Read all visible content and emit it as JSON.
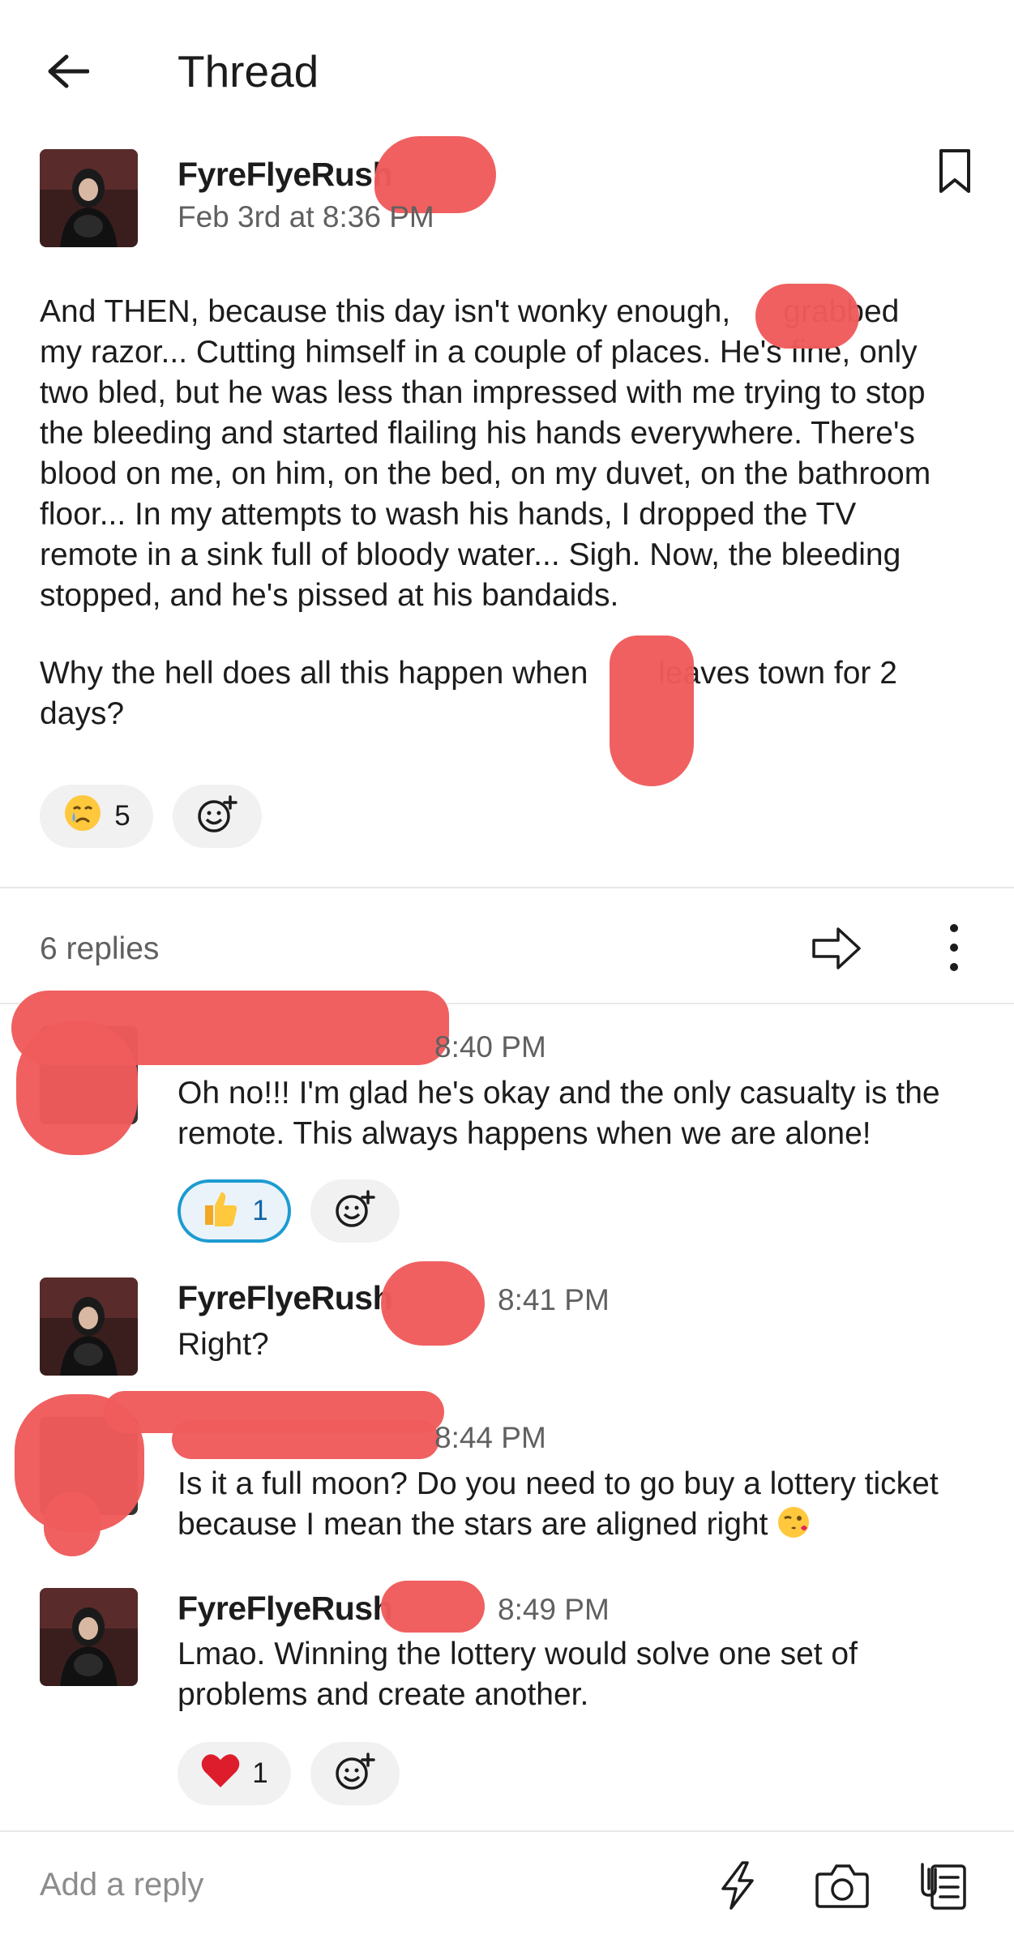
{
  "header": {
    "title": "Thread"
  },
  "parent": {
    "author": "FyreFlyeRush",
    "timestamp": "Feb 3rd at 8:36 PM",
    "text_p1": "And THEN, because this day isn't wonky enough,      grabbed\nmy razor... Cutting himself in a couple of places. He's fine, only\ntwo bled, but he was less than impressed with me trying to stop\nthe bleeding and started flailing his hands everywhere. There's\nblood on me, on him, on the bed, on my duvet, on the bathroom\nfloor... In my attempts to wash his hands, I dropped the TV\nremote in a sink full of bloody water... Sigh. Now, the bleeding\nstopped, and he's pissed at his bandaids.",
    "text_p2": "Why the hell does all this happen when        leaves town for 2\ndays?",
    "reaction": {
      "emoji": "crying-face",
      "count": "5"
    }
  },
  "thread_bar": {
    "replies_label": "6 replies"
  },
  "replies": [
    {
      "timestamp": "8:40 PM",
      "text": "Oh no!!! I'm glad he's okay and the only casualty is the\nremote. This always happens when we are alone!",
      "reaction": {
        "emoji": "thumbs-up",
        "count": "1"
      }
    },
    {
      "author": "FyreFlyeRush",
      "timestamp": "8:41 PM",
      "text": "Right?"
    },
    {
      "timestamp": "8:44 PM",
      "text": "Is it a full moon? Do you need to go buy a lottery ticket\nbecause I mean the stars are aligned right",
      "trailing_emoji": "winking-kiss-face"
    },
    {
      "author": "FyreFlyeRush",
      "timestamp": "8:49 PM",
      "text": "Lmao. Winning the lottery would solve one set of\nproblems and create another.",
      "reaction": {
        "emoji": "red-heart",
        "count": "1"
      }
    }
  ],
  "composer": {
    "placeholder": "Add a reply"
  },
  "colors": {
    "redaction": "#ef5b5b",
    "active_reaction_border": "#1d9bd1",
    "text": "#1d1c1d",
    "muted": "#616061"
  }
}
